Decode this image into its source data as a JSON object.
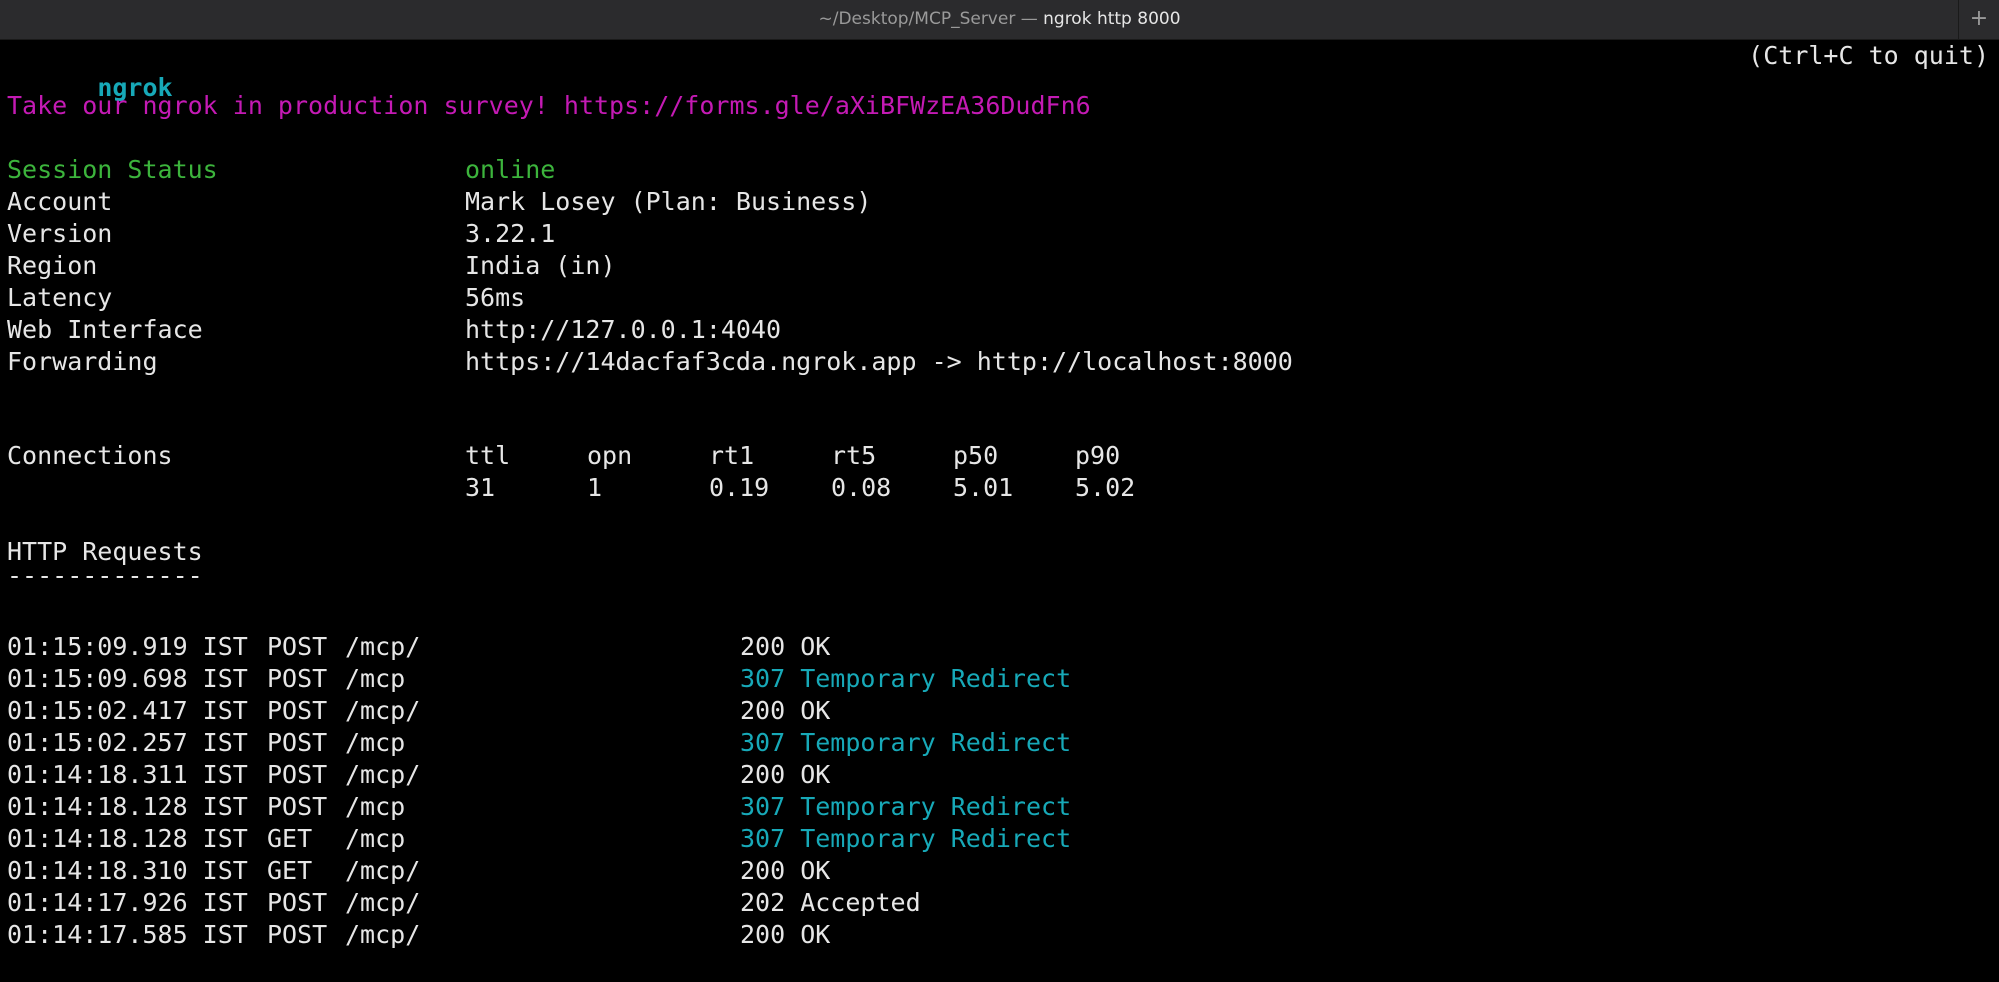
{
  "window": {
    "title_path": "~/Desktop/MCP_Server — ",
    "title_command": "ngrok http 8000",
    "new_tab_label": "+"
  },
  "header": {
    "brand": "ngrok",
    "quit_hint": "(Ctrl+C to quit)"
  },
  "survey": {
    "text": "Take our ngrok in production survey! https://forms.gle/aXiBFWzEA36DudFn6"
  },
  "session": {
    "rows": [
      {
        "label": "Session Status",
        "value": "online"
      },
      {
        "label": "Account",
        "value": "Mark Losey (Plan: Business)"
      },
      {
        "label": "Version",
        "value": "3.22.1"
      },
      {
        "label": "Region",
        "value": "India (in)"
      },
      {
        "label": "Latency",
        "value": "56ms"
      },
      {
        "label": "Web Interface",
        "value": "http://127.0.0.1:4040"
      },
      {
        "label": "Forwarding",
        "value": "https://14dacfaf3cda.ngrok.app -> http://localhost:8000"
      }
    ],
    "colors": {
      "status_online": "#3cb43c"
    }
  },
  "connections": {
    "label": "Connections",
    "headers": [
      "ttl",
      "opn",
      "rt1",
      "rt5",
      "p50",
      "p90"
    ],
    "values": [
      "31",
      "1",
      "0.19",
      "0.08",
      "5.01",
      "5.02"
    ]
  },
  "http": {
    "title": "HTTP Requests",
    "underline": "-------------",
    "requests": [
      {
        "time": "01:15:09.919 IST",
        "method": "POST",
        "path": "/mcp/",
        "status": "200 OK"
      },
      {
        "time": "01:15:09.698 IST",
        "method": "POST",
        "path": "/mcp",
        "status": "307 Temporary Redirect"
      },
      {
        "time": "01:15:02.417 IST",
        "method": "POST",
        "path": "/mcp/",
        "status": "200 OK"
      },
      {
        "time": "01:15:02.257 IST",
        "method": "POST",
        "path": "/mcp",
        "status": "307 Temporary Redirect"
      },
      {
        "time": "01:14:18.311 IST",
        "method": "POST",
        "path": "/mcp/",
        "status": "200 OK"
      },
      {
        "time": "01:14:18.128 IST",
        "method": "POST",
        "path": "/mcp",
        "status": "307 Temporary Redirect"
      },
      {
        "time": "01:14:18.128 IST",
        "method": "GET",
        "path": "/mcp",
        "status": "307 Temporary Redirect"
      },
      {
        "time": "01:14:18.310 IST",
        "method": "GET",
        "path": "/mcp/",
        "status": "200 OK"
      },
      {
        "time": "01:14:17.926 IST",
        "method": "POST",
        "path": "/mcp/",
        "status": "202 Accepted"
      },
      {
        "time": "01:14:17.585 IST",
        "method": "POST",
        "path": "/mcp/",
        "status": "200 OK"
      }
    ],
    "colors": {
      "redirect": "#17a9b8",
      "default": "#e6e6e6"
    }
  },
  "theme": {
    "background": "#000000",
    "foreground": "#e6e6e6",
    "brand": "#17a9b8",
    "survey": "#c41ab4"
  }
}
